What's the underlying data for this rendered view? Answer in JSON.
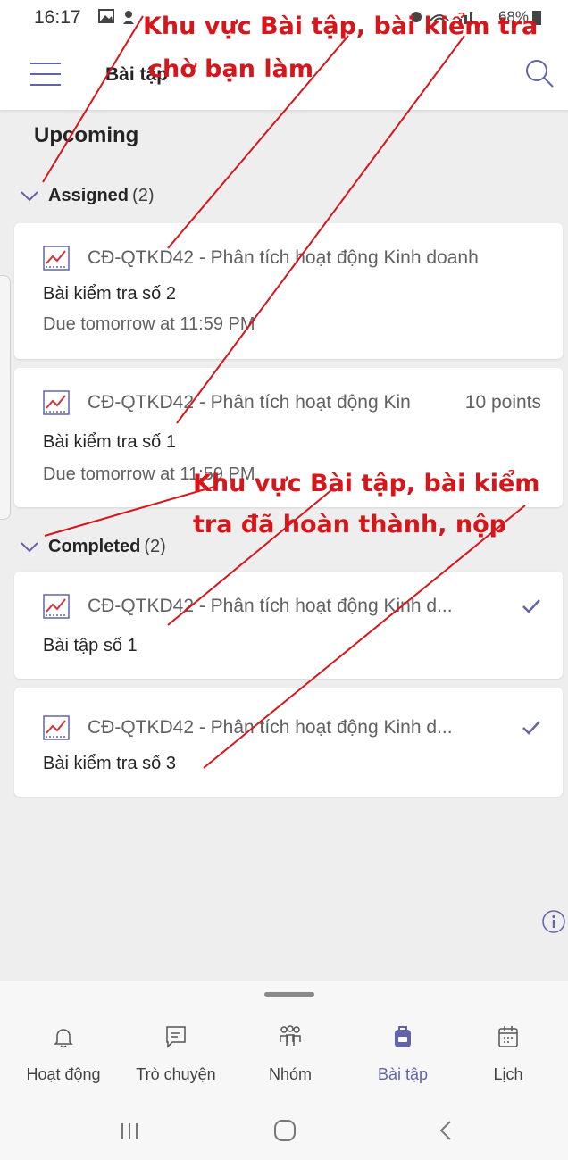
{
  "status_bar": {
    "time": "16:17",
    "right": "68%"
  },
  "header": {
    "title": "Bài tập"
  },
  "section_title": "Upcoming",
  "groups": [
    {
      "name": "Assigned",
      "count": "(2)",
      "items": [
        {
          "course": "CĐ-QTKD42 - Phân tích hoạt động Kinh doanh",
          "title": "Bài kiểm tra số 2",
          "due": "Due tomorrow at 11:59 PM"
        },
        {
          "course": "CĐ-QTKD42 - Phân tích hoạt động Kin",
          "points": "10 points",
          "title": "Bài kiểm tra số 1",
          "due": "Due tomorrow at 11:59 PM"
        }
      ]
    },
    {
      "name": "Completed",
      "count": "(2)",
      "items": [
        {
          "course": "CĐ-QTKD42 - Phân tích hoạt động Kinh d...",
          "title": "Bài tập số 1"
        },
        {
          "course": "CĐ-QTKD42 - Phân tích hoạt động Kinh d...",
          "title": "Bài kiểm tra số 3"
        }
      ]
    }
  ],
  "bottom_tabs": [
    {
      "label": "Hoạt động",
      "icon": "bell-icon"
    },
    {
      "label": "Trò chuyện",
      "icon": "chat-icon"
    },
    {
      "label": "Nhóm",
      "icon": "teams-icon"
    },
    {
      "label": "Bài tập",
      "icon": "backpack-icon",
      "active": true
    },
    {
      "label": "Lịch",
      "icon": "calendar-icon"
    }
  ],
  "annotations": {
    "top_line1": "Khu vực Bài tập, bài kiểm tra",
    "top_line2": "chờ bạn làm",
    "mid_line1": "Khu vực Bài tập, bài kiểm",
    "mid_line2": "tra đã hoàn thành, nộp"
  },
  "colors": {
    "accent": "#6264a7",
    "annotation": "#d6161b",
    "background": "#eeeeee"
  }
}
